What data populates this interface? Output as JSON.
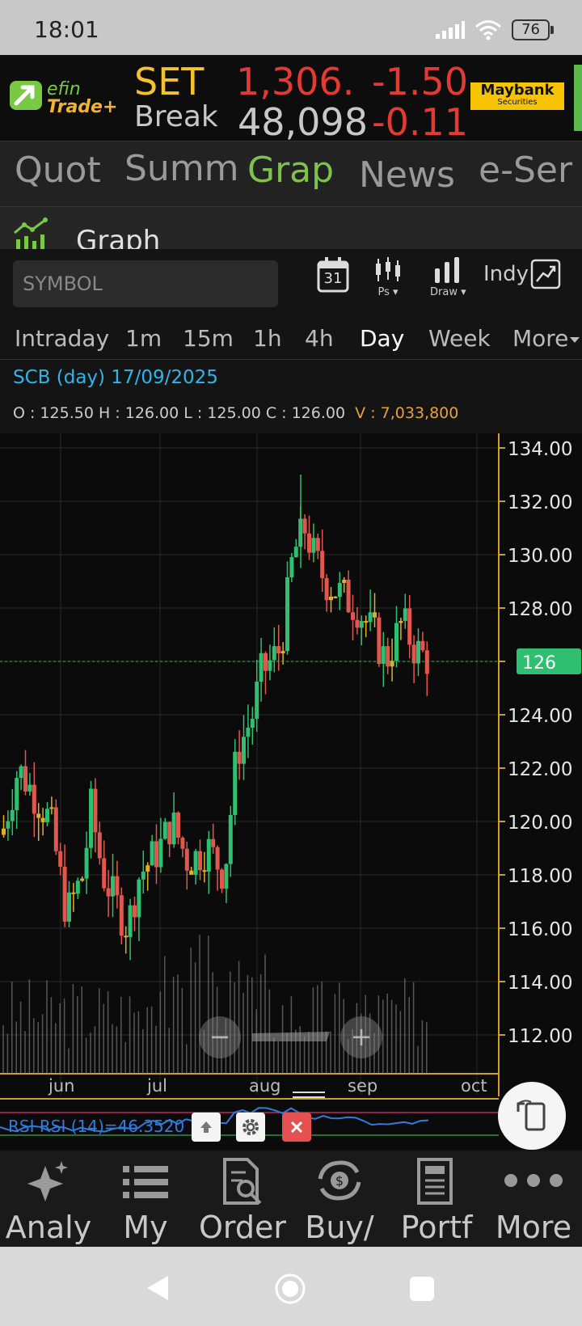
{
  "status": {
    "time": "18:01",
    "battery": "76"
  },
  "ticker": {
    "brand_top": "efin",
    "brand_bottom": "Trade+",
    "row1": {
      "name": "SET",
      "value": "1,306.",
      "change": "-1.50"
    },
    "row2": {
      "name": "Break",
      "value": "48,098",
      "change": "-0.11"
    },
    "broker": "Maybank",
    "broker_sub": "Securities"
  },
  "tabs": [
    "Quot",
    "Summ",
    "Grap",
    "News",
    "e-Ser"
  ],
  "active_tab": "Grap",
  "section_title": "Graph",
  "symbol_placeholder": "SYMBOL",
  "tools": {
    "calendar_day": "31",
    "ps": "Ps ▾",
    "draw": "Draw ▾",
    "indy": "Indy"
  },
  "timeframes": [
    "Intraday",
    "1m",
    "15m",
    "1h",
    "4h",
    "Day",
    "Week",
    "More"
  ],
  "active_timeframe": "Day",
  "info": {
    "title": "SCB (day) 17/09/2025",
    "ohlc": "O : 125.50  H : 126.00  L : 125.00  C : 126.00",
    "volume": "V : 7,033,800"
  },
  "chart_data": {
    "type": "candlestick",
    "symbol": "SCB",
    "ylim": [
      111,
      134.3
    ],
    "y_ticks": [
      "134.00",
      "132.00",
      "130.00",
      "128.00",
      "126.00",
      "124.00",
      "122.00",
      "120.00",
      "118.00",
      "116.00",
      "114.00",
      "112.00"
    ],
    "x_labels": [
      "jun",
      "jul",
      "aug",
      "sep",
      "oct"
    ],
    "current_price_label": "126",
    "current_price": 126,
    "rsi_label": "RSI RSI (14)=46.3520",
    "colors": {
      "up": "#2fbf71",
      "down": "#e2574c",
      "neutral": "#e0b020",
      "price_line": "#2fbf71",
      "axis": "#c9a227"
    }
  },
  "bottom_nav": [
    "Analy",
    "My",
    "Order",
    "Buy/",
    "Portf",
    "More"
  ]
}
